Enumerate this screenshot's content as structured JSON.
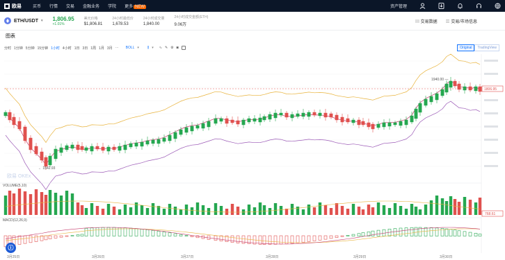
{
  "nav": {
    "logo": "欧易",
    "items": [
      {
        "label": "买币"
      },
      {
        "label": "行情"
      },
      {
        "label": "交易"
      },
      {
        "label": "金融业务"
      },
      {
        "label": "学院"
      },
      {
        "label": "更多",
        "badge": "NEW"
      }
    ],
    "asset_label": "资产管理"
  },
  "ticker": {
    "pair": "ETH/USDT",
    "price": "1,806.95",
    "change": "+1.01%",
    "stats": [
      {
        "label": "美元价格",
        "value": "$1,806.81"
      },
      {
        "label": "24小时最低价",
        "value": "1,678.53"
      },
      {
        "label": "24小时成交量",
        "value": "1,840.00"
      },
      {
        "label": "24小时成交金额(ETH)",
        "value": "9.06万"
      }
    ],
    "right_links": [
      "交易数据",
      "交易/市场信息"
    ]
  },
  "section_title": "图表",
  "toolbar": {
    "intervals": [
      "分时",
      "1分钟",
      "5分钟",
      "15分钟",
      "1小时",
      "4小时",
      "1日",
      "3日",
      "1周",
      "1月",
      "3月"
    ],
    "active_interval": "1小时",
    "indicator": "BOLL"
  },
  "view_switch": {
    "options": [
      "Original",
      "TradingView"
    ],
    "active": "Original"
  },
  "chart_data": {
    "type": "candlestick",
    "watermark": "欧易 OKEx",
    "high_label": "1940.00",
    "low_label": "1542.93",
    "last_price_label": "1806.95",
    "volume_label": "VOLUME(5,10)",
    "macd_label": "MACD(12,26,9)",
    "volume_last": "768.61",
    "x_ticks": [
      "3月25日",
      "3月26日",
      "3月27日",
      "3月28日",
      "3月29日",
      "3月30日"
    ],
    "colors": {
      "up": "#25a750",
      "down": "#e0514e",
      "boll_upper": "#e8b23a",
      "boll_mid": "#c43a6b",
      "boll_lower": "#9b59b6"
    }
  }
}
